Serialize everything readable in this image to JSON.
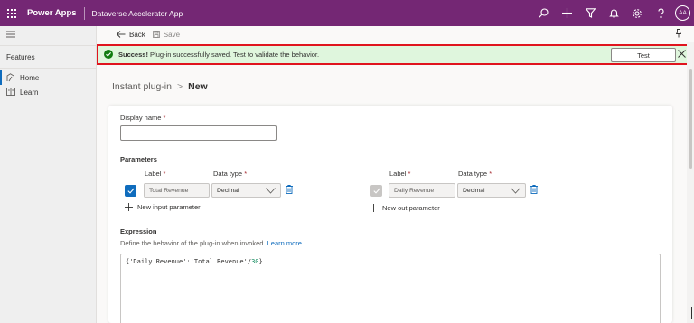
{
  "header": {
    "app_name": "Power Apps",
    "environment": "Dataverse Accelerator App",
    "avatar_initials": "AA",
    "color": "#742774"
  },
  "nav": {
    "section_title": "Features",
    "items": [
      {
        "label": "Home",
        "icon": "home-icon",
        "active": true
      },
      {
        "label": "Learn",
        "icon": "book-icon",
        "active": false
      }
    ]
  },
  "commandbar": {
    "back_label": "Back",
    "save_label": "Save"
  },
  "notification": {
    "title": "Success!",
    "message": "Plug-in successfully saved. Test to validate the behavior.",
    "test_label": "Test",
    "background": "#dff6dd",
    "highlight": "#e0141e"
  },
  "breadcrumb": {
    "parent": "Instant plug-in",
    "separator": ">",
    "current": "New"
  },
  "form": {
    "display_name_label": "Display name",
    "display_name_value": "",
    "required_marker": "*",
    "parameters_title": "Parameters",
    "label_header": "Label",
    "datatype_header": "Data type",
    "input_param": {
      "label": "Total Revenue",
      "datatype": "Decimal",
      "checked": true
    },
    "output_param": {
      "label": "Daily Revenue",
      "datatype": "Decimal",
      "checked": true
    },
    "new_input_label": "New input parameter",
    "new_output_label": "New out parameter",
    "expression_title": "Expression",
    "expression_desc": "Define the behavior of the plug-in when invoked.",
    "learn_more": "Learn more",
    "expression_prefix": "{'Daily Revenue':'Total Revenue'/",
    "expression_number": "30",
    "expression_suffix": "}"
  }
}
